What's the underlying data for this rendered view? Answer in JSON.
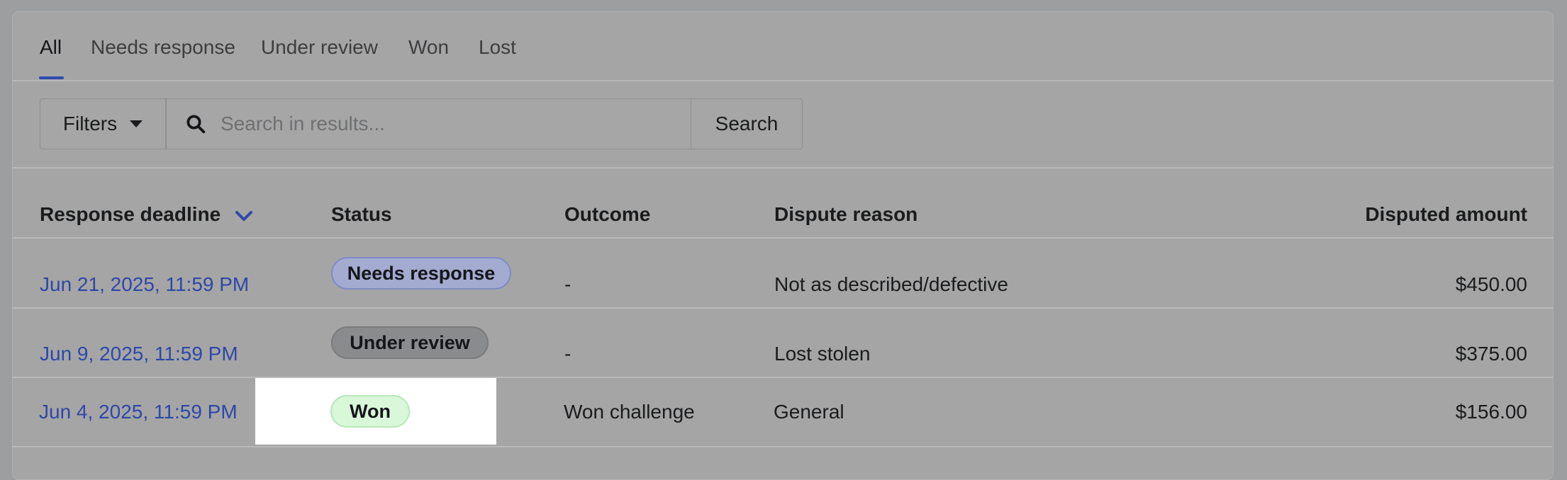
{
  "tabs": [
    {
      "label": "All",
      "active": true
    },
    {
      "label": "Needs response",
      "active": false
    },
    {
      "label": "Under review",
      "active": false
    },
    {
      "label": "Won",
      "active": false
    },
    {
      "label": "Lost",
      "active": false
    }
  ],
  "toolbar": {
    "filters_label": "Filters",
    "search_placeholder": "Search in results...",
    "search_value": "",
    "search_button_label": "Search"
  },
  "table": {
    "columns": {
      "deadline": "Response deadline",
      "status": "Status",
      "outcome": "Outcome",
      "reason": "Dispute reason",
      "amount": "Disputed amount"
    },
    "rows": [
      {
        "deadline": "Jun 21, 2025, 11:59 PM",
        "status": "Needs response",
        "outcome": "-",
        "reason": "Not as described/defective",
        "amount": "$450.00"
      },
      {
        "deadline": "Jun 9, 2025, 11:59 PM",
        "status": "Under review",
        "outcome": "-",
        "reason": "Lost stolen",
        "amount": "$375.00"
      },
      {
        "deadline": "Jun 4, 2025, 11:59 PM",
        "status": "Won",
        "outcome": "Won challenge",
        "reason": "General",
        "amount": "$156.00"
      }
    ]
  },
  "colors": {
    "accent": "#2d48a8",
    "needs_response_badge": "#a3abd0",
    "under_review_badge": "#8a8b8d",
    "won_badge": "#d9f7d9"
  }
}
